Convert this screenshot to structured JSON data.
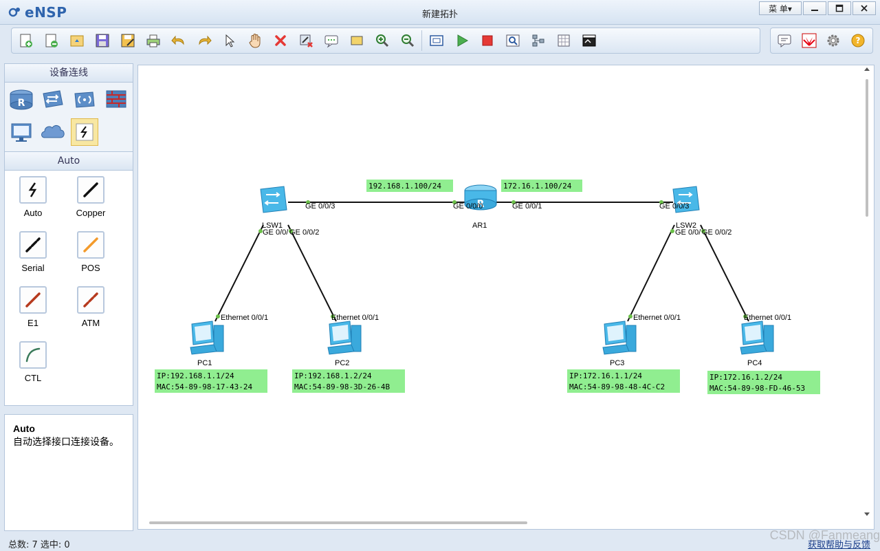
{
  "app": {
    "logo": "eNSP",
    "window_title": "新建拓扑",
    "menu_label": "菜 单▾"
  },
  "toolbar": {
    "icons": [
      "new-topology-icon",
      "new-example-icon",
      "open-icon",
      "save-icon",
      "save-as-icon",
      "print-icon",
      "undo-icon",
      "redo-icon",
      "select-icon",
      "pan-hand-icon",
      "delete-icon",
      "delete-link-icon",
      "text-icon",
      "rectangle-icon",
      "zoom-in-icon",
      "zoom-out-icon",
      "fit-icon",
      "start-device-icon",
      "stop-device-icon",
      "capture-icon",
      "topology-icon",
      "grid-icon",
      "console-icon"
    ],
    "right_icons": [
      "chat-icon",
      "huawei-logo-icon",
      "settings-gear-icon",
      "help-icon"
    ]
  },
  "left_panel": {
    "device_header": "设备连线",
    "devices": [
      "router-icon",
      "switch-icon",
      "wireless-icon",
      "firewall-icon",
      "pc-icon",
      "cloud-icon",
      "auto-cable-icon"
    ],
    "cable_header": "Auto",
    "cables": [
      {
        "label": "Auto",
        "color": "#111111"
      },
      {
        "label": "Copper",
        "color": "#111111"
      },
      {
        "label": "Serial",
        "color": "#111111"
      },
      {
        "label": "POS",
        "color": "#f39a2b"
      },
      {
        "label": "E1",
        "color": "#b63a1e"
      },
      {
        "label": "ATM",
        "color": "#b63a1e"
      },
      {
        "label": "CTL",
        "color": "#3a7a5a"
      }
    ],
    "desc_title": "Auto",
    "desc_text": "自动选择接口连接设备。"
  },
  "topology": {
    "devices": [
      {
        "name": "LSW1",
        "type": "switch"
      },
      {
        "name": "AR1",
        "type": "router"
      },
      {
        "name": "LSW2",
        "type": "switch"
      },
      {
        "name": "PC1",
        "type": "pc"
      },
      {
        "name": "PC2",
        "type": "pc"
      },
      {
        "name": "PC3",
        "type": "pc"
      },
      {
        "name": "PC4",
        "type": "pc"
      }
    ],
    "ports": {
      "lsw1_up": "GE 0/0/3",
      "ar1_left": "GE 0/0/0",
      "ar1_right": "GE 0/0/1",
      "lsw2_up": "GE 0/0/3",
      "lsw1_down": "GE 0/0/",
      "lsw1_down2": "GE 0/0/2",
      "lsw2_down": "GE 0/0/",
      "lsw2_down2": "GE 0/0/2",
      "pc_port": "Ethernet 0/0/1"
    },
    "ip_labels": {
      "ar1_left": "192.168.1.100/24",
      "ar1_right": "172.16.1.100/24"
    },
    "pc_info": [
      {
        "ip": "IP:192.168.1.1/24",
        "mac": "MAC:54-89-98-17-43-24"
      },
      {
        "ip": "IP:192.168.1.2/24",
        "mac": "MAC:54-89-98-3D-26-4B"
      },
      {
        "ip": "IP:172.16.1.1/24",
        "mac": "MAC:54-89-98-48-4C-C2"
      },
      {
        "ip": "IP:172.16.1.2/24",
        "mac": "MAC:54-89-98-FD-46-53"
      }
    ],
    "label_bg": "#90ee90",
    "link_color": "#111111",
    "port_dot_color": "#6cc04a"
  },
  "status": {
    "text": "总数: 7  选中: 0",
    "feedback": "获取帮助与反馈",
    "watermark": "CSDN @Fanmeang"
  }
}
